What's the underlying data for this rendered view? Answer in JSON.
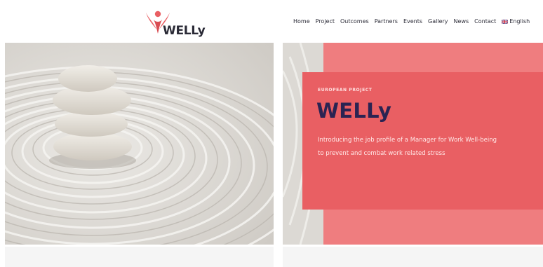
{
  "brand": {
    "name": "WELLy",
    "accent": "#e95f63",
    "accent_light": "#ef7d7f",
    "title_color": "#2b2352"
  },
  "nav": {
    "items": [
      "Home",
      "Project",
      "Outcomes",
      "Partners",
      "Events",
      "Gallery",
      "News",
      "Contact"
    ],
    "language": "English",
    "language_icon": "uk-flag-icon"
  },
  "hero": {
    "eyebrow": "EUROPEAN PROJECT",
    "title": "WELLy",
    "description_line1": "Introducing the job profile of a Manager for Work Well-being",
    "description_line2": "to prevent and combat work related stress"
  }
}
